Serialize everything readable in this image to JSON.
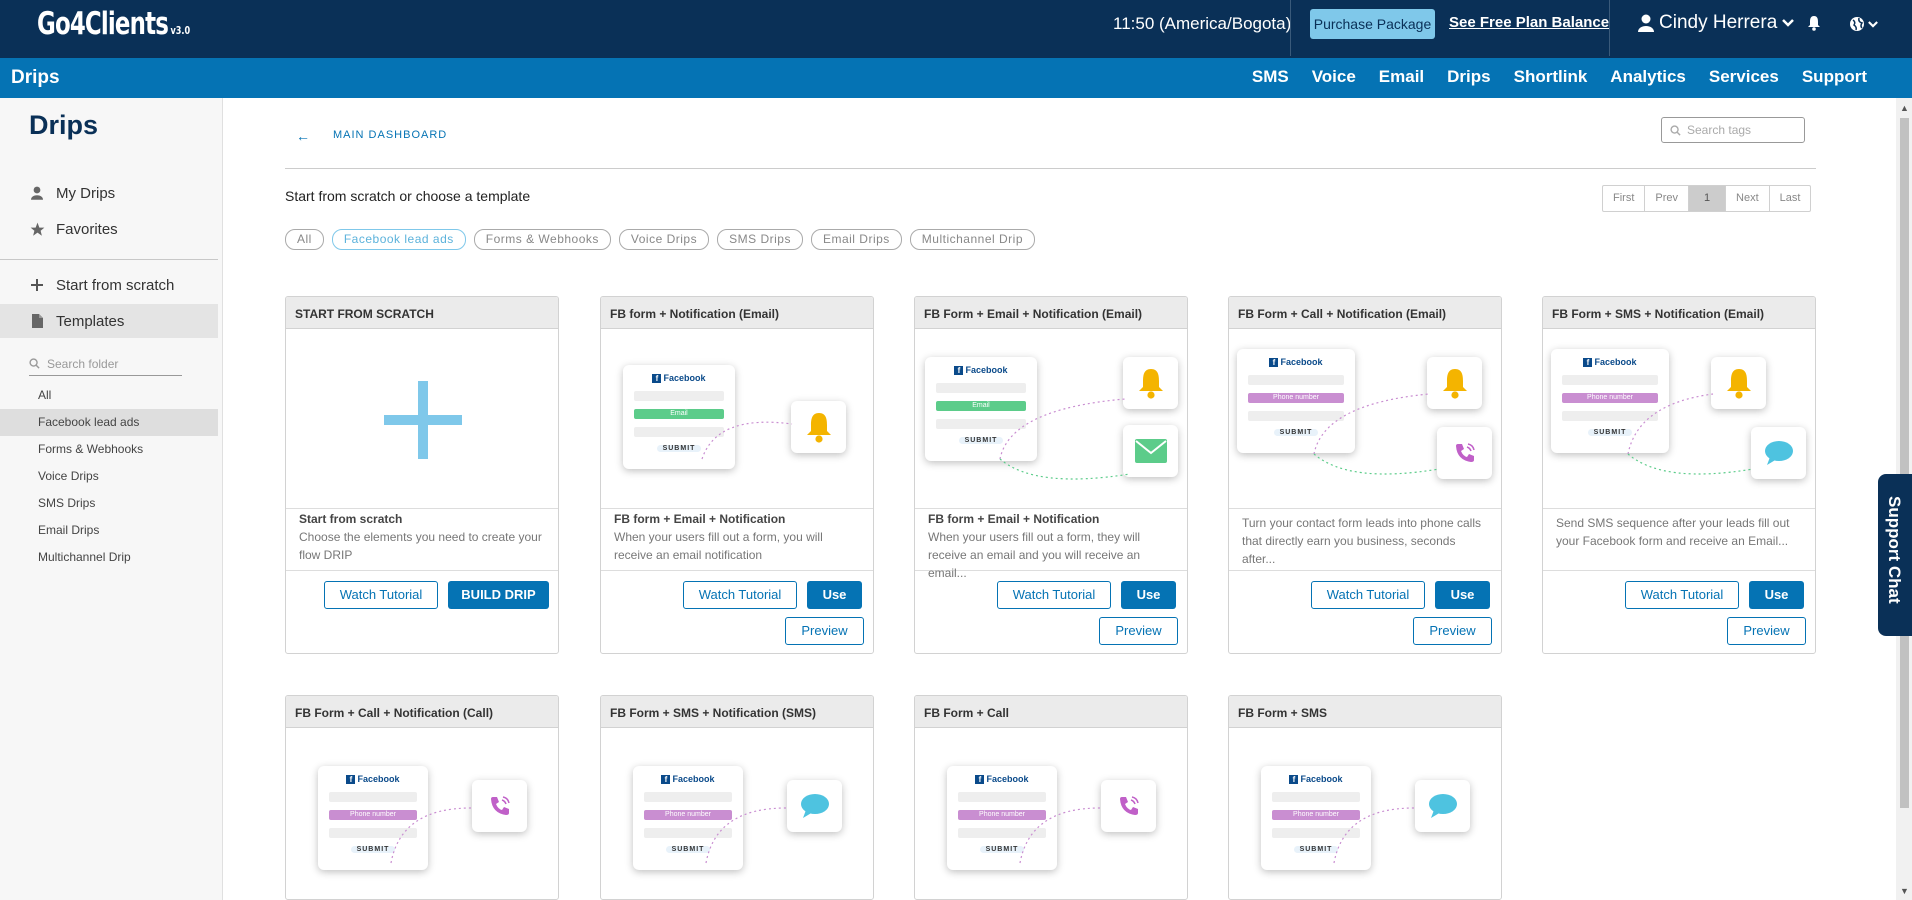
{
  "header": {
    "logo": "Go4Clients",
    "version": "v3.0",
    "clock": "11:50 (America/Bogota)",
    "purchase_label": "Purchase Package",
    "balance_label": "See Free Plan Balance",
    "user_name": "Cindy Herrera"
  },
  "nav": {
    "title": "Drips",
    "links": [
      "SMS",
      "Voice",
      "Email",
      "Drips",
      "Shortlink",
      "Analytics",
      "Services",
      "Support"
    ]
  },
  "sidebar": {
    "title": "Drips",
    "my_drips": "My Drips",
    "favorites": "Favorites",
    "start_scratch": "Start from scratch",
    "templates": "Templates",
    "search_placeholder": "Search folder",
    "folders": [
      "All",
      "Facebook lead ads",
      "Forms & Webhooks",
      "Voice Drips",
      "SMS Drips",
      "Email Drips",
      "Multichannel Drip"
    ]
  },
  "main": {
    "back_label": "MAIN DASHBOARD",
    "search_placeholder": "Search tags",
    "subtitle": "Start from scratch or choose a template",
    "pager": {
      "first": "First",
      "prev": "Prev",
      "page": "1",
      "next": "Next",
      "last": "Last"
    },
    "chips": [
      "All",
      "Facebook lead ads",
      "Forms & Webhooks",
      "Voice Drips",
      "SMS Drips",
      "Email Drips",
      "Multichannel Drip"
    ],
    "active_chip": "Facebook lead ads"
  },
  "labels": {
    "watch": "Watch Tutorial",
    "use": "Use",
    "preview": "Preview",
    "build": "BUILD DRIP",
    "facebook": "Facebook",
    "email": "Email",
    "phone": "Phone number",
    "submit": "SUBMIT"
  },
  "cards": [
    {
      "title": "START FROM SCRATCH",
      "name": "Start from scratch",
      "desc": "Choose the elements you need to create your flow DRIP"
    },
    {
      "title": "FB form + Notification (Email)",
      "name": "FB form + Email + Notification",
      "desc": "When your users fill out a form, you will receive an email notification"
    },
    {
      "title": "FB Form + Email + Notification (Email)",
      "name": "FB form + Email + Notification",
      "desc": "When your users fill out a form, they will receive an email and you will receive an email..."
    },
    {
      "title": "FB Form + Call + Notification (Email)",
      "name": "",
      "desc": "Turn your contact form leads into phone calls that directly earn you business, seconds after..."
    },
    {
      "title": "FB Form + SMS + Notification (Email)",
      "name": "",
      "desc": "Send SMS sequence after your leads fill out your Facebook form and receive an Email..."
    },
    {
      "title": "FB Form + Call + Notification (Call)"
    },
    {
      "title": "FB Form + SMS + Notification (SMS)"
    },
    {
      "title": "FB Form + Call"
    },
    {
      "title": "FB Form + SMS"
    }
  ],
  "support_chat": "Support Chat",
  "colors": {
    "dark_navy": "#0a3057",
    "brand_blue": "#0573b4",
    "light_blue": "#7fc8ea",
    "bell_yellow": "#f4b400",
    "chat_blue": "#4ec3e0",
    "phone_purple": "#c060c8",
    "email_green": "#5ccc8a"
  }
}
